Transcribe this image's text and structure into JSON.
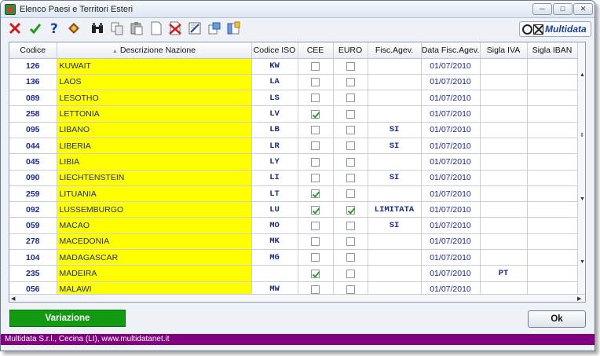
{
  "window": {
    "title": "Elenco Paesi e Territori Esteri"
  },
  "brand": {
    "name": "Multidata"
  },
  "toolbar": {
    "icons": [
      "close-red-x-icon",
      "confirm-green-check-icon",
      "help-question-icon",
      "edit-pencil-icon",
      "binoculars-search-icon",
      "copy-page-icon",
      "paste-page-icon",
      "new-page-icon",
      "delete-page-icon",
      "edit-page-icon",
      "export-icon",
      "columns-icon"
    ]
  },
  "grid": {
    "headers": [
      "Codice",
      "Descrizione Nazione",
      "Codice ISO",
      "CEE",
      "EURO",
      "Fisc.Agev.",
      "Data Fisc.Agev.",
      "Sigla IVA",
      "Sigla IBAN"
    ],
    "sort_indicator": "▲",
    "rows": [
      {
        "code": "126",
        "desc": "KUWAIT",
        "iso": "KW",
        "cee": false,
        "euro": false,
        "fisc": "",
        "date": "01/07/2010",
        "iva": "",
        "iban": ""
      },
      {
        "code": "136",
        "desc": "LAOS",
        "iso": "LA",
        "cee": false,
        "euro": false,
        "fisc": "",
        "date": "01/07/2010",
        "iva": "",
        "iban": ""
      },
      {
        "code": "089",
        "desc": "LESOTHO",
        "iso": "LS",
        "cee": false,
        "euro": false,
        "fisc": "",
        "date": "01/07/2010",
        "iva": "",
        "iban": ""
      },
      {
        "code": "258",
        "desc": "LETTONIA",
        "iso": "LV",
        "cee": true,
        "euro": false,
        "fisc": "",
        "date": "01/07/2010",
        "iva": "",
        "iban": ""
      },
      {
        "code": "095",
        "desc": "LIBANO",
        "iso": "LB",
        "cee": false,
        "euro": false,
        "fisc": "SI",
        "date": "01/07/2010",
        "iva": "",
        "iban": ""
      },
      {
        "code": "044",
        "desc": "LIBERIA",
        "iso": "LR",
        "cee": false,
        "euro": false,
        "fisc": "SI",
        "date": "01/07/2010",
        "iva": "",
        "iban": ""
      },
      {
        "code": "045",
        "desc": "LIBIA",
        "iso": "LY",
        "cee": false,
        "euro": false,
        "fisc": "",
        "date": "01/07/2010",
        "iva": "",
        "iban": ""
      },
      {
        "code": "090",
        "desc": "LIECHTENSTEIN",
        "iso": "LI",
        "cee": false,
        "euro": false,
        "fisc": "SI",
        "date": "01/07/2010",
        "iva": "",
        "iban": ""
      },
      {
        "code": "259",
        "desc": "LITUANIA",
        "iso": "LT",
        "cee": true,
        "euro": false,
        "fisc": "",
        "date": "01/07/2010",
        "iva": "",
        "iban": ""
      },
      {
        "code": "092",
        "desc": "LUSSEMBURGO",
        "iso": "LU",
        "cee": true,
        "euro": true,
        "fisc": "LIMITATA",
        "date": "01/07/2010",
        "iva": "",
        "iban": ""
      },
      {
        "code": "059",
        "desc": "MACAO",
        "iso": "MO",
        "cee": false,
        "euro": false,
        "fisc": "SI",
        "date": "01/07/2010",
        "iva": "",
        "iban": ""
      },
      {
        "code": "278",
        "desc": "MACEDONIA",
        "iso": "MK",
        "cee": false,
        "euro": false,
        "fisc": "",
        "date": "01/07/2010",
        "iva": "",
        "iban": ""
      },
      {
        "code": "104",
        "desc": "MADAGASCAR",
        "iso": "MG",
        "cee": false,
        "euro": false,
        "fisc": "",
        "date": "01/07/2010",
        "iva": "",
        "iban": ""
      },
      {
        "code": "235",
        "desc": "MADEIRA",
        "iso": "",
        "cee": true,
        "euro": false,
        "fisc": "",
        "date": "01/07/2010",
        "iva": "PT",
        "iban": ""
      },
      {
        "code": "056",
        "desc": "MALAWI",
        "iso": "MW",
        "cee": false,
        "euro": false,
        "fisc": "",
        "date": "01/07/2010",
        "iva": "",
        "iban": ""
      }
    ]
  },
  "buttons": {
    "variazione": "Variazione",
    "ok": "Ok"
  },
  "status": {
    "text": "Multidata S.r.l., Cecina (LI), www.multidatanet.it"
  },
  "colors": {
    "highlight": "#ffff00",
    "variazione": "#139a13",
    "statusbar": "#800080",
    "text_blue": "#1b2a8a"
  }
}
